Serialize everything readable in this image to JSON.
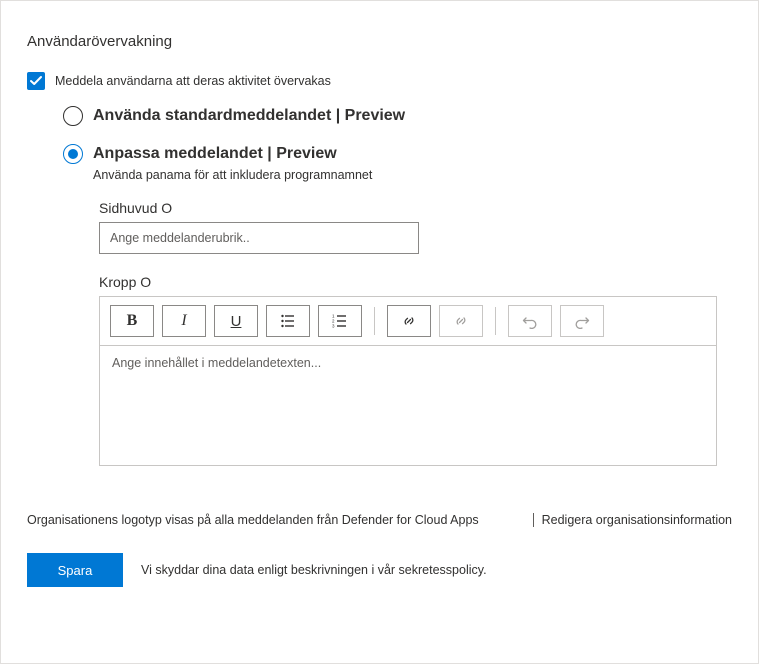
{
  "title": "Användarövervakning",
  "notify": {
    "checkbox_label": "Meddela användarna att deras aktivitet övervakas"
  },
  "radios": {
    "standard": {
      "label": "Använda standardmeddelandet | Preview"
    },
    "custom": {
      "label": "Anpassa meddelandet | Preview",
      "sub": "Använda panama för att inkludera programnamnet"
    }
  },
  "header_field": {
    "label": "Sidhuvud O",
    "placeholder": "Ange meddelanderubrik.."
  },
  "body_field": {
    "label": "Kropp O",
    "placeholder": "Ange innehållet i meddelandetexten..."
  },
  "toolbar": {
    "bold": "B",
    "italic": "I",
    "underline": "U"
  },
  "footer": {
    "logo_note": "Organisationens logotyp visas på alla meddelanden från Defender for Cloud Apps",
    "edit_org": "Redigera organisationsinformation"
  },
  "save": {
    "button": "Spara",
    "note": "Vi skyddar dina data enligt beskrivningen i vår sekretesspolicy."
  }
}
